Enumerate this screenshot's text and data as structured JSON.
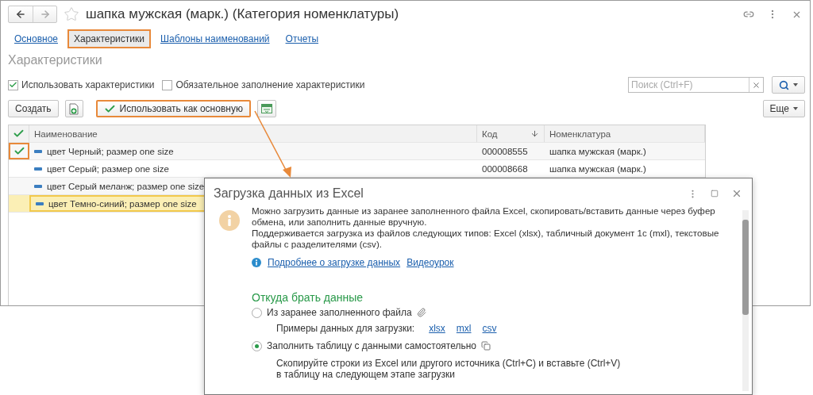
{
  "window": {
    "title": "шапка мужская (марк.) (Категория номенклатуры)",
    "tabs": [
      {
        "label": "Основное",
        "selected": false,
        "highlighted": false
      },
      {
        "label": "Характеристики",
        "selected": true,
        "highlighted": true
      },
      {
        "label": "Шаблоны наименований",
        "selected": false,
        "highlighted": false
      },
      {
        "label": "Отчеты",
        "selected": false,
        "highlighted": false
      }
    ],
    "section_title": "Характеристики",
    "options": [
      {
        "label": "Использовать характеристики",
        "checked": true
      },
      {
        "label": "Обязательное заполнение характеристики",
        "checked": false
      }
    ],
    "search": {
      "placeholder": "Поиск (Ctrl+F)"
    },
    "toolbar": {
      "create": "Создать",
      "use_as_main": {
        "label": "Использовать как основную",
        "highlighted": true
      },
      "more": "Еще"
    },
    "table": {
      "columns": [
        {
          "label": "Наименование"
        },
        {
          "label": "Код",
          "sorted": true
        },
        {
          "label": "Номенклатура"
        }
      ],
      "rows": [
        {
          "name": "цвет Черный; размер one size",
          "code": "000008555",
          "nomenclature": "шапка мужская (марк.)",
          "main": true,
          "selected": false,
          "highlighted": true
        },
        {
          "name": "цвет Серый; размер one size",
          "code": "000008668",
          "nomenclature": "шапка мужская (марк.)",
          "main": false,
          "selected": false,
          "highlighted": false
        },
        {
          "name": "цвет Серый меланж; размер one size",
          "main": false,
          "selected": false,
          "highlighted": false
        },
        {
          "name": "цвет Темно-синий; размер one size",
          "main": false,
          "selected": true,
          "highlighted": false
        }
      ]
    }
  },
  "dialog": {
    "title": "Загрузка данных из Excel",
    "paragraphs": [
      "Можно загрузить данные из заранее заполненного файла Excel, скопировать/вставить данные через буфер обмена, или заполнить данные вручную.",
      "Поддерживается загрузка из файлов следующих типов: Excel (xlsx), табличный документ 1с (mxl), текстовые файлы с разделителями (csv)."
    ],
    "links": [
      "Подробнее о загрузке данных",
      "Видеоурок"
    ],
    "section": "Откуда брать данные",
    "options": [
      {
        "kind": "file",
        "label": "Из заранее заполненного файла",
        "selected": false,
        "examples_label": "Примеры данных для загрузки:",
        "examples": [
          "xlsx",
          "mxl",
          "csv"
        ]
      },
      {
        "kind": "manual",
        "label": "Заполнить таблицу с данными самостоятельно",
        "selected": true,
        "hint": "Скопируйте строки из Excel или другого источника (Ctrl+C) и вставьте (Ctrl+V) в таблицу на следующем этапе загрузки"
      }
    ]
  }
}
